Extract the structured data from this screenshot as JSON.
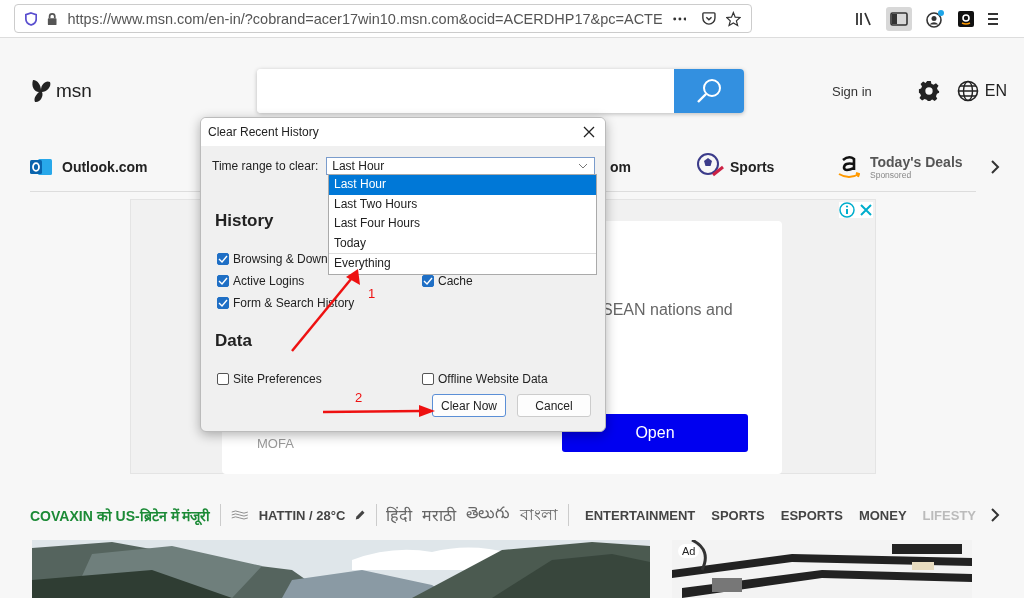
{
  "browser": {
    "url": "https://www.msn.com/en-in/?cobrand=acer17win10.msn.com&ocid=ACERDHP17&pc=ACTE"
  },
  "header": {
    "logo": "msn",
    "sign_in": "Sign in",
    "language": "EN"
  },
  "nav": [
    {
      "label": "Outlook.com",
      "kind": "outlook"
    },
    {
      "label": "om",
      "kind": "plain"
    },
    {
      "label": "Sports",
      "kind": "sports"
    },
    {
      "label": "Today's Deals",
      "sublabel": "Sponsored",
      "kind": "deals"
    }
  ],
  "ad": {
    "text": "SEAN nations and",
    "source": "MOFA",
    "button": "Open"
  },
  "dialog": {
    "title": "Clear Recent History",
    "range_label": "Time range to clear:",
    "range_value": "Last Hour",
    "options": [
      {
        "label": "Last Hour",
        "selected": true
      },
      {
        "label": "Last Two Hours",
        "selected": false
      },
      {
        "label": "Last Four Hours",
        "selected": false
      },
      {
        "label": "Today",
        "selected": false
      },
      {
        "label": "Everything",
        "selected": false
      }
    ],
    "history_heading": "History",
    "history_rows": [
      {
        "items": [
          {
            "label": "Browsing & Down",
            "checked": true
          }
        ]
      },
      {
        "items": [
          {
            "label": "Active Logins",
            "checked": true
          },
          {
            "label": "Cache",
            "checked": true
          }
        ]
      },
      {
        "items": [
          {
            "label": "Form & Search History",
            "checked": true
          }
        ]
      }
    ],
    "data_heading": "Data",
    "data": [
      {
        "label": "Site Preferences",
        "checked": false
      },
      {
        "label": "Offline Website Data",
        "checked": false
      }
    ],
    "buttons": [
      {
        "label": "Clear Now",
        "default": true
      },
      {
        "label": "Cancel",
        "default": false
      }
    ]
  },
  "annotations": [
    "1",
    "2"
  ],
  "strip": {
    "headline": "COVAXIN को US-ब्रिटेन में मंजूरी",
    "weather": "HATTIN / 28°C",
    "languages": [
      "हिंदी",
      "मराठी",
      "తెలుగు",
      "বাংলা"
    ],
    "categories": [
      {
        "label": "ENTERTAINMENT",
        "faded": false
      },
      {
        "label": "SPORTS",
        "faded": false
      },
      {
        "label": "ESPORTS",
        "faded": false
      },
      {
        "label": "MONEY",
        "faded": false
      },
      {
        "label": "LIFESTY",
        "faded": true
      }
    ]
  },
  "bottom_ad": {
    "label": "Ad"
  }
}
